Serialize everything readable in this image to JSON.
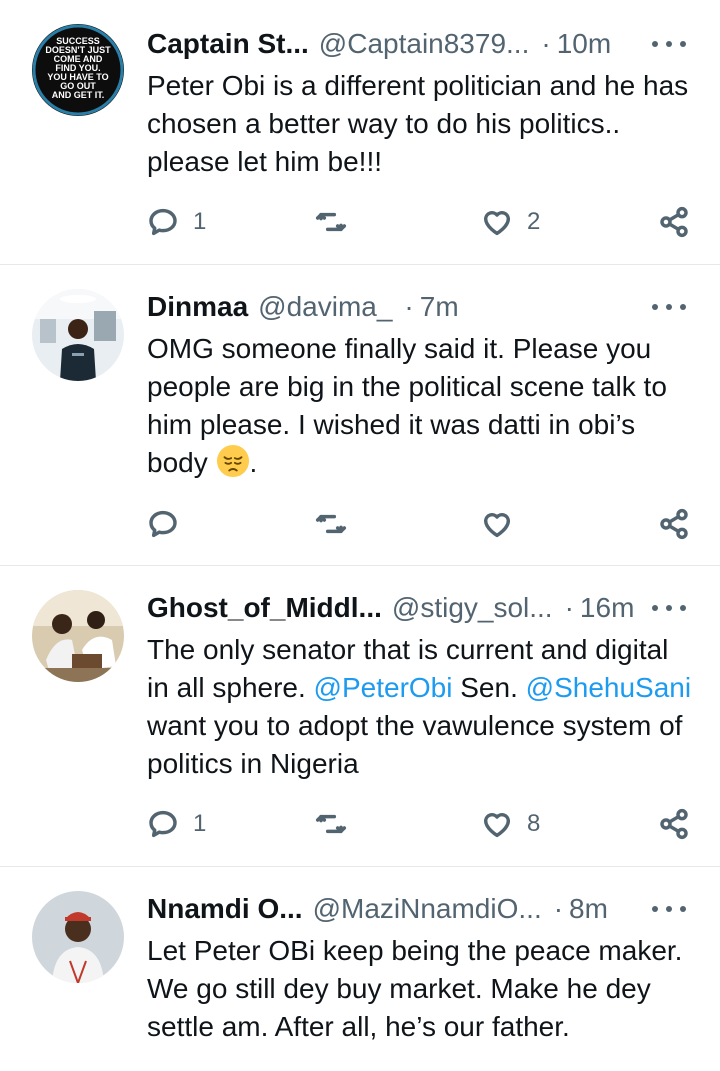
{
  "tweets": [
    {
      "name": "Captain St...",
      "handle": "@Captain8379...",
      "sep": "·",
      "time": "10m",
      "avatar_text": [
        "SUCCESS",
        "DOESN'T JUST",
        "COME AND",
        "FIND YOU.",
        "YOU HAVE TO",
        "GO OUT",
        "AND GET IT."
      ],
      "body": "Peter Obi is a different politician and he has chosen a better way to do his politics.. please let him be!!!",
      "replies": "1",
      "retweets": "",
      "likes": "2"
    },
    {
      "name": "Dinmaa",
      "handle": "@davima_",
      "sep": "·",
      "time": "7m",
      "body_before_emoji": "OMG someone finally said it. Please you people are big in the political scene talk to him please. I wished it was datti in obi’s body ",
      "body_after_emoji": ".",
      "emoji": "pensive-face",
      "replies": "",
      "retweets": "",
      "likes": ""
    },
    {
      "name": "Ghost_of_Middl...",
      "handle": "@stigy_sol...",
      "sep": "·",
      "time": "16m",
      "body_part1": "The only senator that is current and digital in all sphere. ",
      "mention1": "@PeterObi",
      "body_part2": " Sen. ",
      "mention2": "@ShehuSani",
      "body_part3": " want you to adopt the vawulence system of politics in Nigeria",
      "replies": "1",
      "retweets": "",
      "likes": "8"
    },
    {
      "name": "Nnamdi O...",
      "handle": "@MaziNnamdiO...",
      "sep": "·",
      "time": "8m",
      "body": "Let Peter OBi keep being the peace maker. We go still dey buy market. Make he dey settle am. After all, he’s our father."
    }
  ],
  "colors": {
    "text": "#0f1419",
    "muted": "#536471",
    "link": "#1d9bf0",
    "divider": "#e6e9ec"
  },
  "icons": [
    "reply-icon",
    "retweet-icon",
    "like-icon",
    "share-icon",
    "more-icon"
  ]
}
